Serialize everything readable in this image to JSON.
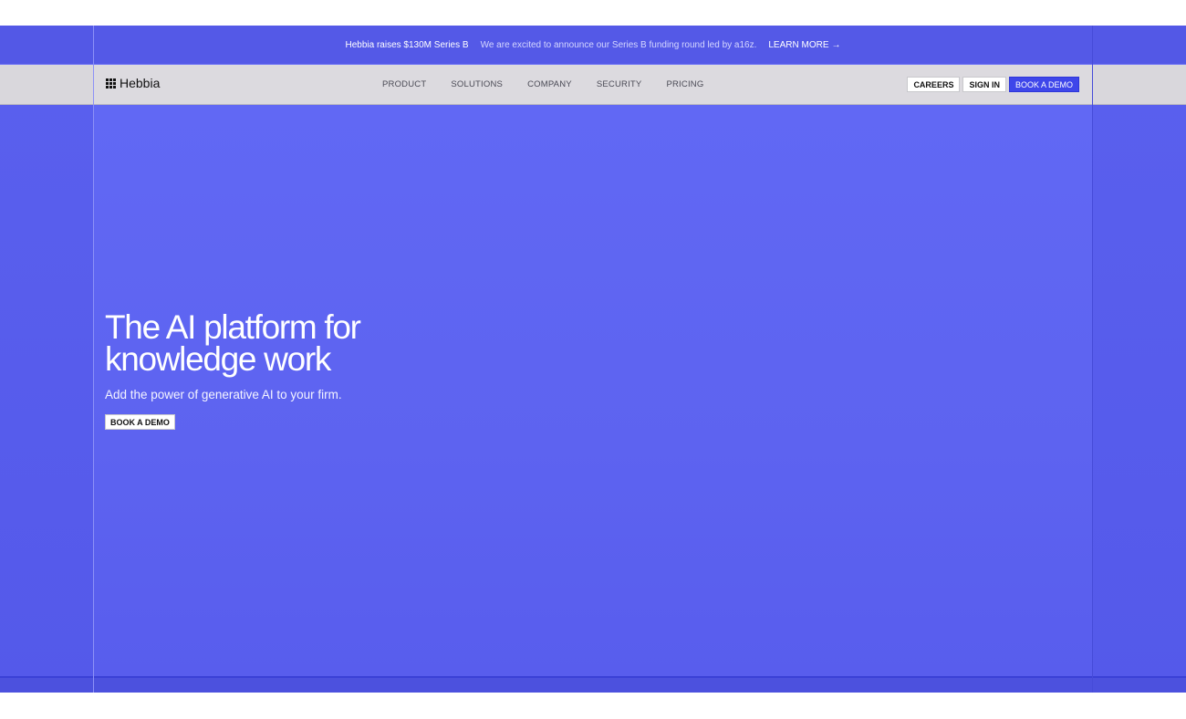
{
  "announcement": {
    "headline": "Hebbia raises $130M Series B",
    "message": "We are excited to announce our Series B funding round led by a16z.",
    "link_label": "LEARN MORE",
    "link_icon": "arrow-right-icon"
  },
  "navbar": {
    "logo_text": "Hebbia",
    "logo_icon": "grid-logo-icon",
    "links": [
      "PRODUCT",
      "SOLUTIONS",
      "COMPANY",
      "SECURITY",
      "PRICING"
    ],
    "careers_label": "CAREERS",
    "signin_label": "SIGN IN",
    "demo_label": "BOOK A DEMO"
  },
  "hero": {
    "title_line1": "The AI platform for",
    "title_line2": "knowledge work",
    "subtitle": "Add the power of generative AI to your firm.",
    "cta_label": "BOOK A DEMO"
  },
  "colors": {
    "accent": "#5d63f0",
    "nav_bg": "#dcdadf",
    "primary_button": "#3e46ea"
  }
}
